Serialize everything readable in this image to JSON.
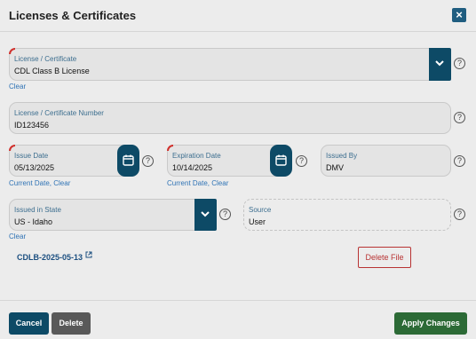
{
  "dialog": {
    "title": "Licenses & Certificates"
  },
  "license": {
    "label": "License / Certificate",
    "value": "CDL Class B License",
    "clear": "Clear"
  },
  "number": {
    "label": "License / Certificate Number",
    "value": "ID123456"
  },
  "issue_date": {
    "label": "Issue Date",
    "value": "05/13/2025",
    "current_date": "Current Date",
    "clear": "Clear"
  },
  "expiration_date": {
    "label": "Expiration Date",
    "value": "10/14/2025",
    "current_date": "Current Date",
    "clear": "Clear"
  },
  "issued_by": {
    "label": "Issued By",
    "value": "DMV"
  },
  "state": {
    "label": "Issued in State",
    "value": "US - Idaho",
    "clear": "Clear"
  },
  "source": {
    "label": "Source",
    "value": "User"
  },
  "file": {
    "name": "CDLB-2025-05-13",
    "delete_label": "Delete File"
  },
  "footer": {
    "cancel": "Cancel",
    "delete": "Delete",
    "apply": "Apply Changes"
  },
  "help_glyph": "?",
  "close_glyph": "×",
  "separator": ", ",
  "icons": [
    "close-icon",
    "chevron-down-icon",
    "calendar-icon",
    "help-icon",
    "external-link-icon"
  ],
  "colors": {
    "primary": "#0d4a66",
    "apply": "#2c6a36",
    "delete": "#595959",
    "danger": "#b83333",
    "link": "#2f73b5",
    "required_marker": "#d0312d"
  }
}
